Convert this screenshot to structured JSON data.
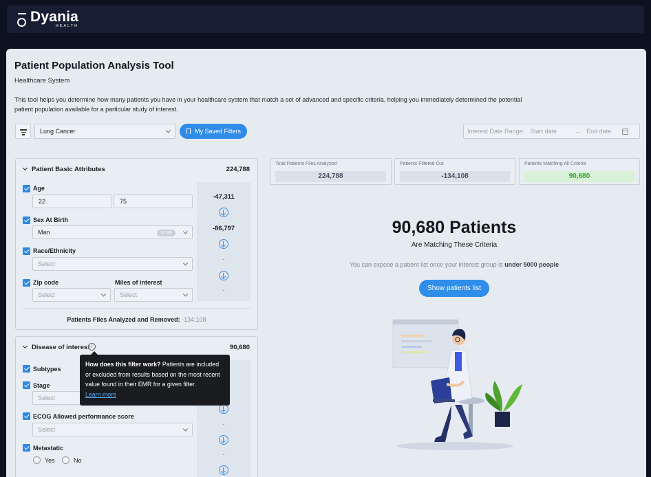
{
  "brand": {
    "name": "Dyania",
    "sub": "HEALTH"
  },
  "page": {
    "title": "Patient Population Analysis Tool",
    "subtitle": "Healthcare System",
    "description": "This tool helps you determine how many patients you have in your healthcare system that match a set of advanced and specific criteria, helping you immediately determined the potential patient population available for a particular study of interest."
  },
  "toolbar": {
    "disease_select": "Lung Cancer",
    "saved_filters": "My Saved Filters",
    "date_label": "Interest Date Range:",
    "start_placeholder": "Start date",
    "arrow": "→",
    "end_placeholder": "End date"
  },
  "basic": {
    "title": "Patient Basic Attributes",
    "count": "224,788",
    "age": {
      "label": "Age",
      "min": "22",
      "max": "75",
      "removed": "-47,311"
    },
    "sex": {
      "label": "Sex At Birth",
      "value": "Man",
      "chip": "90,680",
      "removed": "-86,797"
    },
    "race": {
      "label": "Race/Ethnicity",
      "placeholder": "Select",
      "removed": "-"
    },
    "zip": {
      "label": "Zip code",
      "miles_label": "Miles of interest",
      "placeholder": "Select",
      "miles_placeholder": "Select",
      "removed": "-"
    },
    "summary_label": "Patients Files Analyzed and Removed:",
    "summary_value": "-134,108"
  },
  "disease": {
    "title": "Disease of interest",
    "count": "90,680",
    "info": "i",
    "subtypes": {
      "label": "Subtypes"
    },
    "stage": {
      "label": "Stage",
      "placeholder": "Select"
    },
    "ecog": {
      "label": "ECOG Allowed performance score",
      "placeholder": "Select",
      "removed": "-"
    },
    "metastatic": {
      "label": "Metastatic",
      "yes": "Yes",
      "no": "No",
      "removed": "-"
    }
  },
  "tooltip": {
    "bold": "How does this filter work?",
    "text": " Patients are included or excluded from results based on the most recent value found in their EMR for a given filter.",
    "link": "Learn more"
  },
  "stats": [
    {
      "label": "Total Patients Files Analyzed",
      "value": "224,788"
    },
    {
      "label": "Patients Filtered Out",
      "value": "-134,108"
    },
    {
      "label": "Patients Matching All Criteria",
      "value": "90,680"
    }
  ],
  "result": {
    "headline": "90,680 Patients",
    "sub": "Are Matching These Criteria",
    "hint_pre": "You can expose a patient list once your interest group is ",
    "hint_bold": "under 5000 people",
    "button": "Show patients list"
  },
  "colors": {
    "accent": "#2e8ee9",
    "match_green": "#2da62d",
    "topbar": "#171d33"
  }
}
